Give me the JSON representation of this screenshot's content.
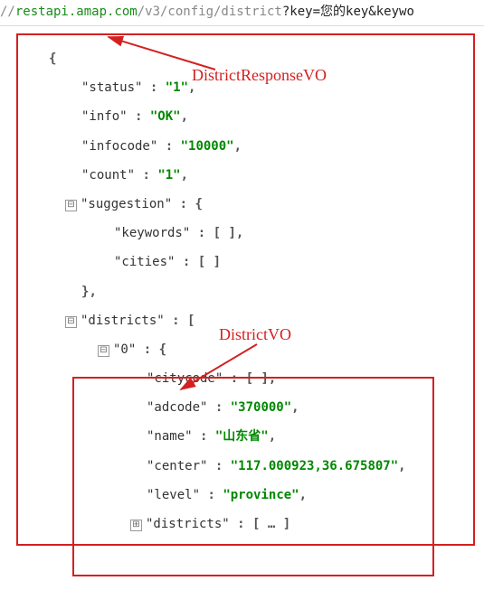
{
  "url": {
    "prefix": "//",
    "host": "restapi.amap.com",
    "path": "/v3/config/district",
    "query_raw": "?key=您的key&keywo"
  },
  "annotations": {
    "label1": "DistrictResponseVO",
    "label2": "DistrictVO"
  },
  "json": {
    "keys": {
      "status": "\"status\"",
      "info": "\"info\"",
      "infocode": "\"infocode\"",
      "count": "\"count\"",
      "suggestion": "\"suggestion\"",
      "keywords": "\"keywords\"",
      "cities": "\"cities\"",
      "districts": "\"districts\"",
      "zero": "\"0\"",
      "citycode": "\"citycode\"",
      "adcode": "\"adcode\"",
      "name": "\"name\"",
      "center": "\"center\"",
      "level": "\"level\"",
      "districts2": "\"districts\""
    },
    "vals": {
      "status": "\"1\"",
      "info": "\"OK\"",
      "infocode": "\"10000\"",
      "count": "\"1\"",
      "adcode": "\"370000\"",
      "name": "\"山东省\"",
      "center": "\"117.000923,36.675807\"",
      "level": "\"province\""
    },
    "punct": {
      "colon_sp": " : ",
      "comma": ",",
      "open_brace": "{",
      "close_brace": "}",
      "open_bracket": "[",
      "close_bracket": "]",
      "empty_arr": "[ ]",
      "ellipsis_arr": "[ … ]"
    },
    "toggles": {
      "minus": "⊟",
      "plus": "⊞"
    }
  }
}
